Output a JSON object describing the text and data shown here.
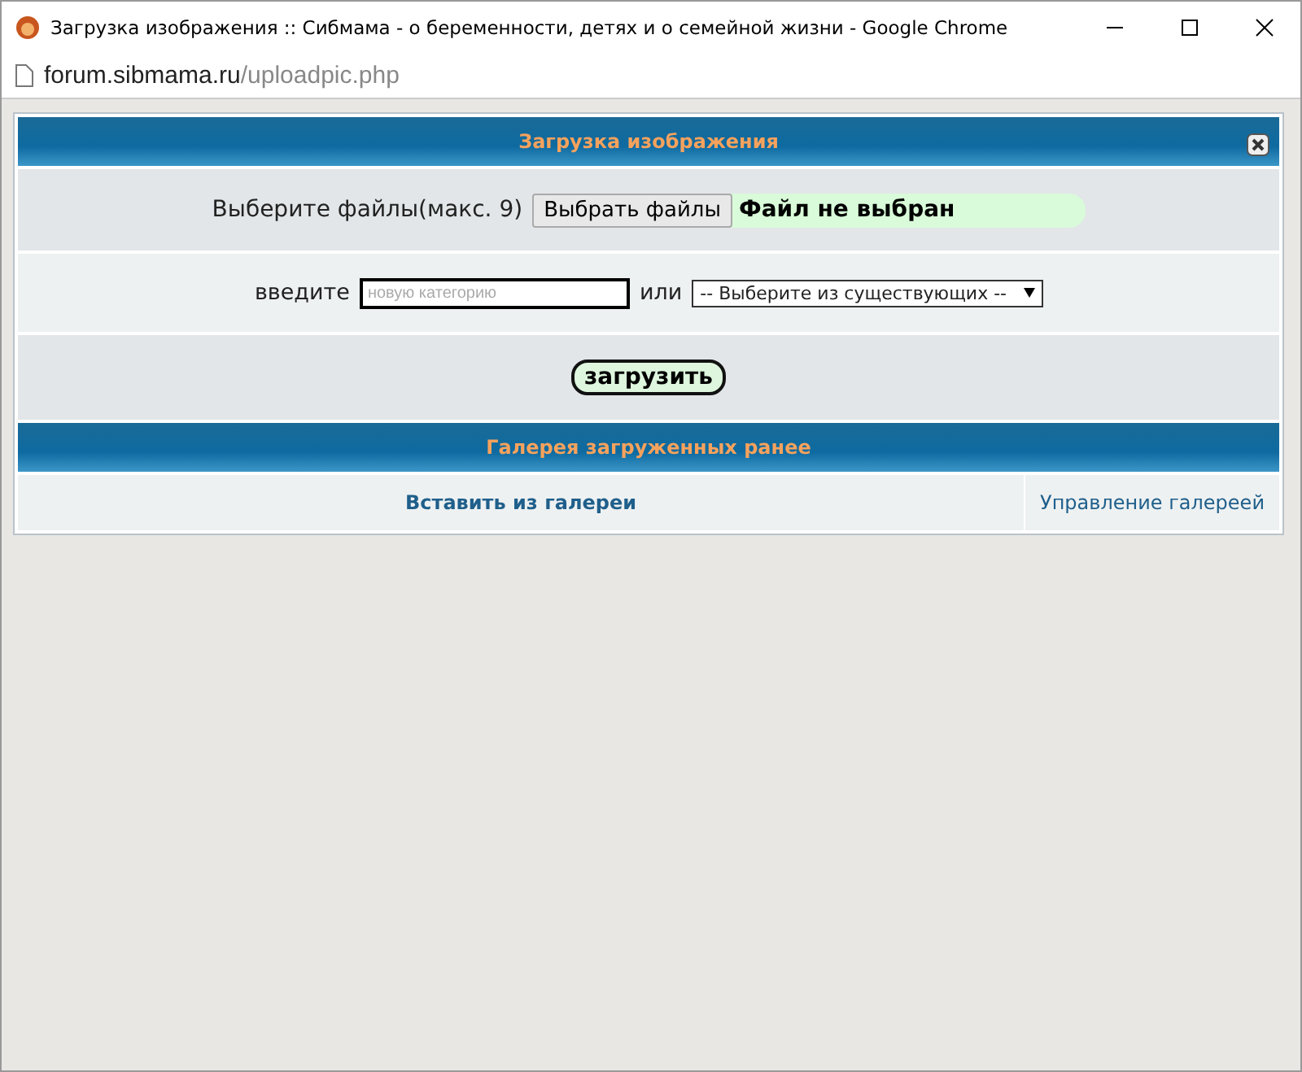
{
  "window": {
    "title": "Загрузка изображения :: Сибмама - о беременности, детях и о семейной жизни - Google Chrome"
  },
  "address_bar": {
    "host": "forum.sibmama.ru",
    "path": "/uploadpic.php"
  },
  "upload_panel": {
    "title": "Загрузка изображения",
    "file_row": {
      "label": "Выберите файлы(макс. 9)",
      "button": "Выбрать файлы",
      "status": "Файл не выбран"
    },
    "category_row": {
      "label": "введите",
      "placeholder": "новую категорию",
      "or": "или",
      "select": "-- Выберите из существующих --"
    },
    "submit": "загрузить"
  },
  "gallery_panel": {
    "title": "Галерея загруженных ранее",
    "insert_link": "Вставить из галереи",
    "manage_link": "Управление галереей"
  }
}
